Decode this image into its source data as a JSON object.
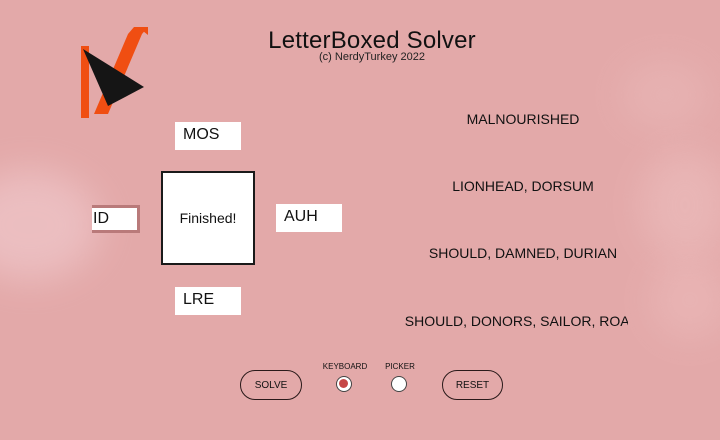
{
  "app": {
    "title": "LetterBoxed Solver",
    "subtitle": "(c) NerdyTurkey 2022",
    "logo_icon": "letterboxed-logo-icon"
  },
  "colors": {
    "background": "#e3a9a9",
    "logo_orange": "#f04e12",
    "logo_black": "#151515",
    "radio_selected": "#c64747"
  },
  "sides": {
    "top": "MOS",
    "left": "ID",
    "right": "AUH",
    "bottom": "LRE"
  },
  "board": {
    "status": "Finished!"
  },
  "solutions": [
    "MALNOURISHED",
    "LIONHEAD, DORSUM",
    "SHOULD, DAMNED, DURIAN",
    "SHOULD, DONORS, SAILOR, ROAM"
  ],
  "controls": {
    "solve_label": "SOLVE",
    "reset_label": "RESET",
    "keyboard_label": "KEYBOARD",
    "picker_label": "PICKER",
    "selected_mode": "keyboard"
  }
}
